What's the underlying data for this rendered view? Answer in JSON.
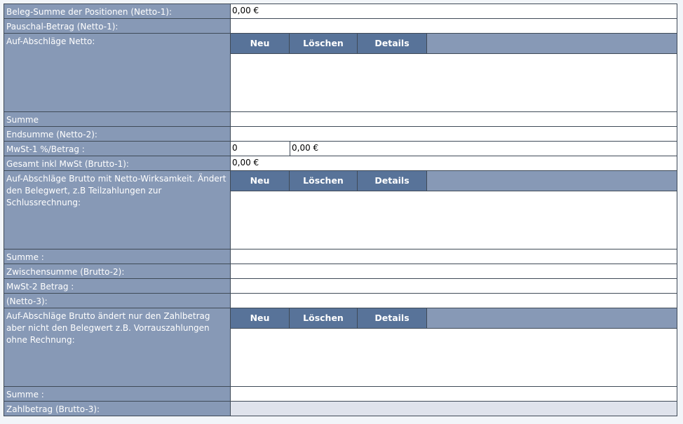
{
  "rows": {
    "beleg_summe": {
      "label": "Beleg-Summe der Positionen (Netto-1):",
      "value": "0,00 €"
    },
    "pauschal": {
      "label": "Pauschal-Betrag (Netto-1):",
      "value": ""
    },
    "auf_netto": {
      "label": "Auf-Abschläge Netto:"
    },
    "summe_1": {
      "label": "Summe",
      "value": ""
    },
    "endsumme": {
      "label": "Endsumme (Netto-2):",
      "value": ""
    },
    "mwst1": {
      "label": "MwSt-1 %/Betrag :",
      "percent": "0",
      "amount": "0,00 €"
    },
    "gesamt": {
      "label": "Gesamt inkl MwSt (Brutto-1):",
      "value": "0,00 €"
    },
    "auf_brutto_wirk": {
      "label": "Auf-Abschläge Brutto mit Netto-Wirksamkeit. Ändert den Belegwert, z.B Teilzahlungen zur Schlussrechnung:"
    },
    "summe_2": {
      "label": "Summe :",
      "value": ""
    },
    "zwischensumme": {
      "label": "Zwischensumme (Brutto-2):",
      "value": ""
    },
    "mwst2": {
      "label": "MwSt-2 Betrag :",
      "value": ""
    },
    "netto3": {
      "label": "(Netto-3):",
      "value": ""
    },
    "auf_brutto_zahl": {
      "label": "Auf-Abschläge Brutto ändert nur den Zahlbetrag aber nicht den Belegwert z.B. Vorrauszahlungen ohne Rechnung:"
    },
    "summe_3": {
      "label": "Summe :",
      "value": ""
    },
    "zahlbetrag": {
      "label": "Zahlbetrag (Brutto-3):",
      "value": ""
    }
  },
  "toolbar": {
    "new_label": "Neu",
    "delete_label": "Löschen",
    "details_label": "Details"
  }
}
